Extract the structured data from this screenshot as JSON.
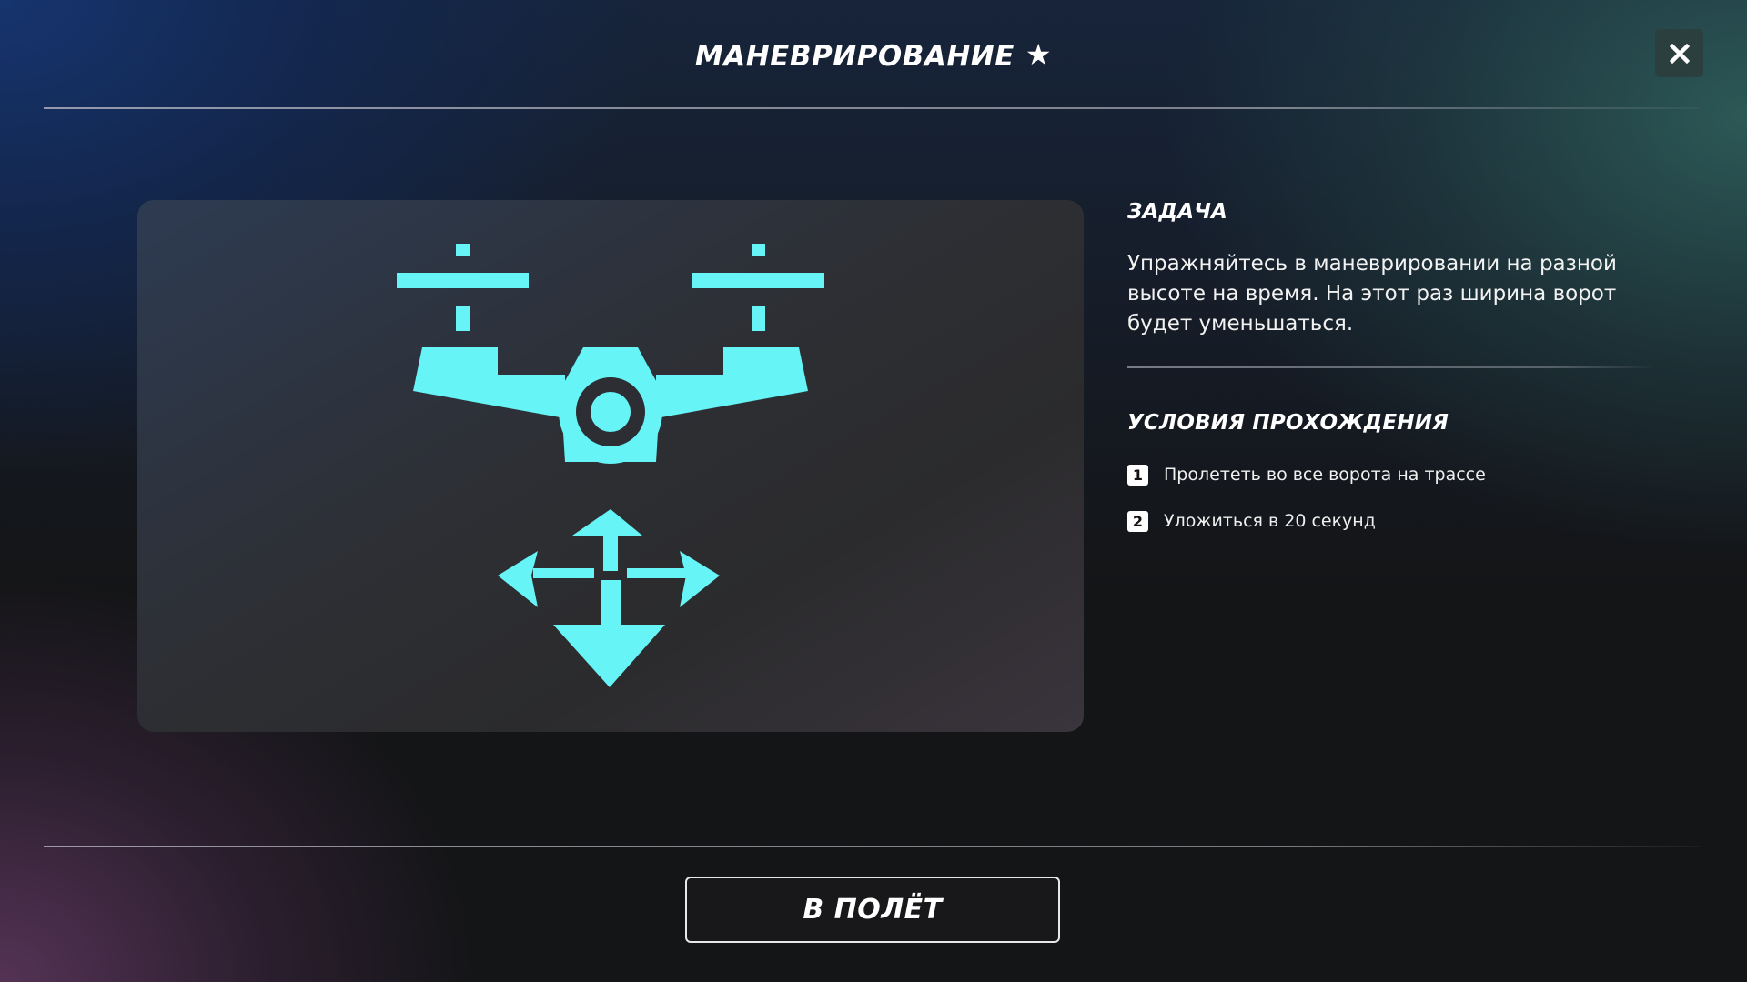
{
  "header": {
    "title": "МАНЕВРИРОВАНИЕ",
    "star_icon": "star-icon",
    "close_icon": "close-icon"
  },
  "illustration": {
    "icons": [
      "drone-icon",
      "move-arrows-icon"
    ],
    "accent_color": "#66f4f6"
  },
  "task": {
    "heading": "ЗАДАЧА",
    "text": "Упражняйтесь в маневрировании на разной высоте на время. На этот раз ширина ворот будет уменьшаться."
  },
  "conditions": {
    "heading": "УСЛОВИЯ ПРОХОЖДЕНИЯ",
    "items": [
      {
        "number": "1",
        "text": "Пролететь во все ворота на трассе"
      },
      {
        "number": "2",
        "text": "Уложиться в 20 секунд"
      }
    ]
  },
  "actions": {
    "fly_label": "В ПОЛЁТ"
  }
}
